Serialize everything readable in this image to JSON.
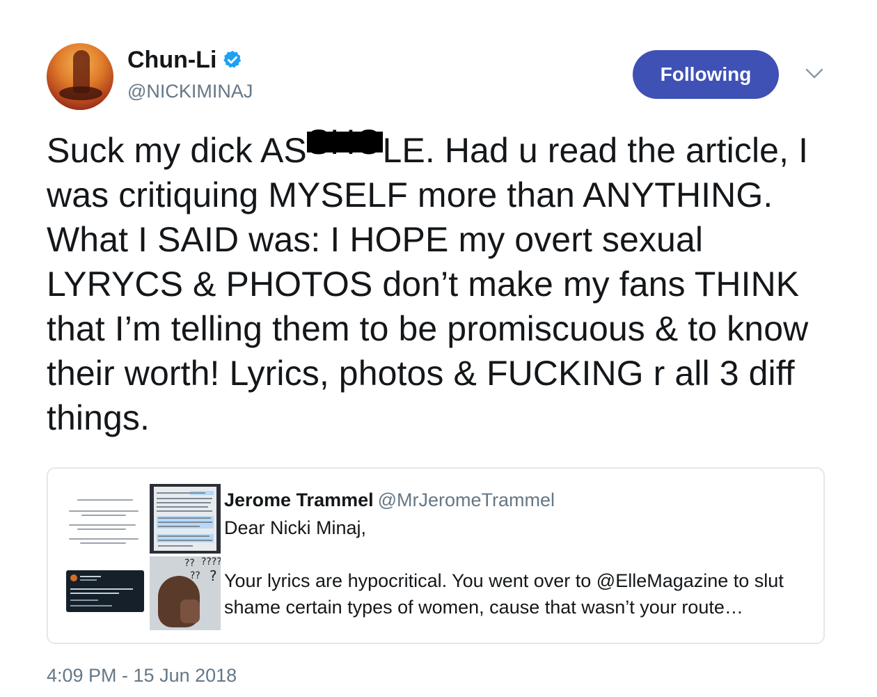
{
  "author": {
    "display_name": "Chun-Li",
    "handle": "@NICKIMINAJ",
    "verified": true,
    "verified_icon": "verified-badge-icon",
    "avatar_icon": "profile-photo"
  },
  "header": {
    "follow_label": "Following",
    "menu_icon": "chevron-down-icon"
  },
  "tweet": {
    "text_before_redaction": "Suck my dick AS",
    "redacted_text": "SHO",
    "text_after_redaction": "LE. Had u read the article, I was critiquing MYSELF more than ANYTHING. What I SAID was: I HOPE my overt sexual LYRYCS & PHOTOS don’t make my fans THINK that I’m telling them to be promiscuous & to know their worth! Lyrics, photos & FUCKING r all 3 diff things."
  },
  "quoted_tweet": {
    "author_name": "Jerome Trammel",
    "author_handle": "@MrJeromeTrammel",
    "greeting": "Dear Nicki Minaj,",
    "body": "Your lyrics are hypocritical. You went over to @ElleMagazine to slut shame certain types of women, cause that wasn’t your route…",
    "media_question_marks": [
      "??",
      "????",
      "??",
      "?"
    ]
  },
  "timestamp": "4:09 PM - 15 Jun 2018",
  "colors": {
    "follow_button": "#3f51b5",
    "verified": "#1da1f2",
    "secondary_text": "#657786",
    "border": "#e1e8ed"
  }
}
